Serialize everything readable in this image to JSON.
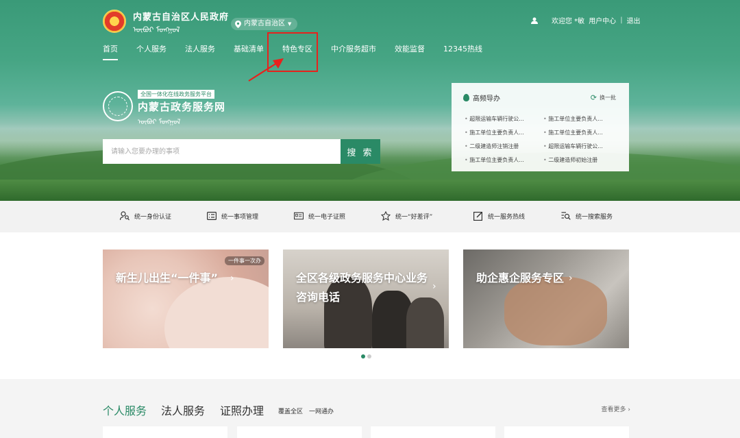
{
  "header": {
    "gov_title": "内蒙古自治区人民政府",
    "gov_script": "ᠥᠪᠦᠷ ᠮᠣᠩᠭᠣᠯ",
    "region": "内蒙古自治区",
    "welcome": "欢迎您 *敏",
    "user_center": "用户中心",
    "separator": "|",
    "logout": "退出"
  },
  "nav": {
    "items": [
      {
        "label": "首页"
      },
      {
        "label": "个人服务"
      },
      {
        "label": "法人服务"
      },
      {
        "label": "基础清单"
      },
      {
        "label": "特色专区"
      },
      {
        "label": "中介服务超市"
      },
      {
        "label": "效能监督"
      },
      {
        "label": "12345热线"
      }
    ]
  },
  "brand": {
    "tag": "全国一体化在线政务服务平台",
    "name": "内蒙古政务服务网",
    "script": "ᠥᠪᠦᠷ ᠮᠣᠩᠭᠣᠯ"
  },
  "search": {
    "placeholder": "请输入您要办理的事项",
    "button": "搜 索"
  },
  "guide": {
    "title": "高频导办",
    "refresh": "换一批",
    "items": [
      {
        "label": "超限运输车辆行驶公..."
      },
      {
        "label": "施工单位主要负责人..."
      },
      {
        "label": "施工单位主要负责人..."
      },
      {
        "label": "施工单位主要负责人..."
      },
      {
        "label": "二级建造师注销注册"
      },
      {
        "label": "超限运输车辆行驶公..."
      },
      {
        "label": "施工单位主要负责人..."
      },
      {
        "label": "二级建造师初始注册"
      }
    ]
  },
  "services": [
    {
      "label": "统一身份认证",
      "icon": "identity-icon"
    },
    {
      "label": "统一事项管理",
      "icon": "list-icon"
    },
    {
      "label": "统一电子证照",
      "icon": "certificate-icon"
    },
    {
      "label": "统一“好差评”",
      "icon": "rating-icon"
    },
    {
      "label": "统一服务热线",
      "icon": "edit-icon"
    },
    {
      "label": "统一搜索服务",
      "icon": "search-list-icon"
    }
  ],
  "cards": [
    {
      "title_line1": "新生儿出生“一件事”",
      "title_line2": "",
      "badge": "一件事一次办"
    },
    {
      "title_line1": "全区各级政务服务中心业务",
      "title_line2": "咨询电话",
      "badge": ""
    },
    {
      "title_line1": "助企惠企服务专区",
      "title_line2": "",
      "badge": ""
    }
  ],
  "section": {
    "tabs": [
      {
        "label": "个人服务"
      },
      {
        "label": "法人服务"
      },
      {
        "label": "证照办理"
      }
    ],
    "sub1": "覆盖全区",
    "sub2": "一网通办",
    "more": "查看更多 ›"
  },
  "colors": {
    "primary": "#2a8a66",
    "annotation": "#e8211c"
  }
}
